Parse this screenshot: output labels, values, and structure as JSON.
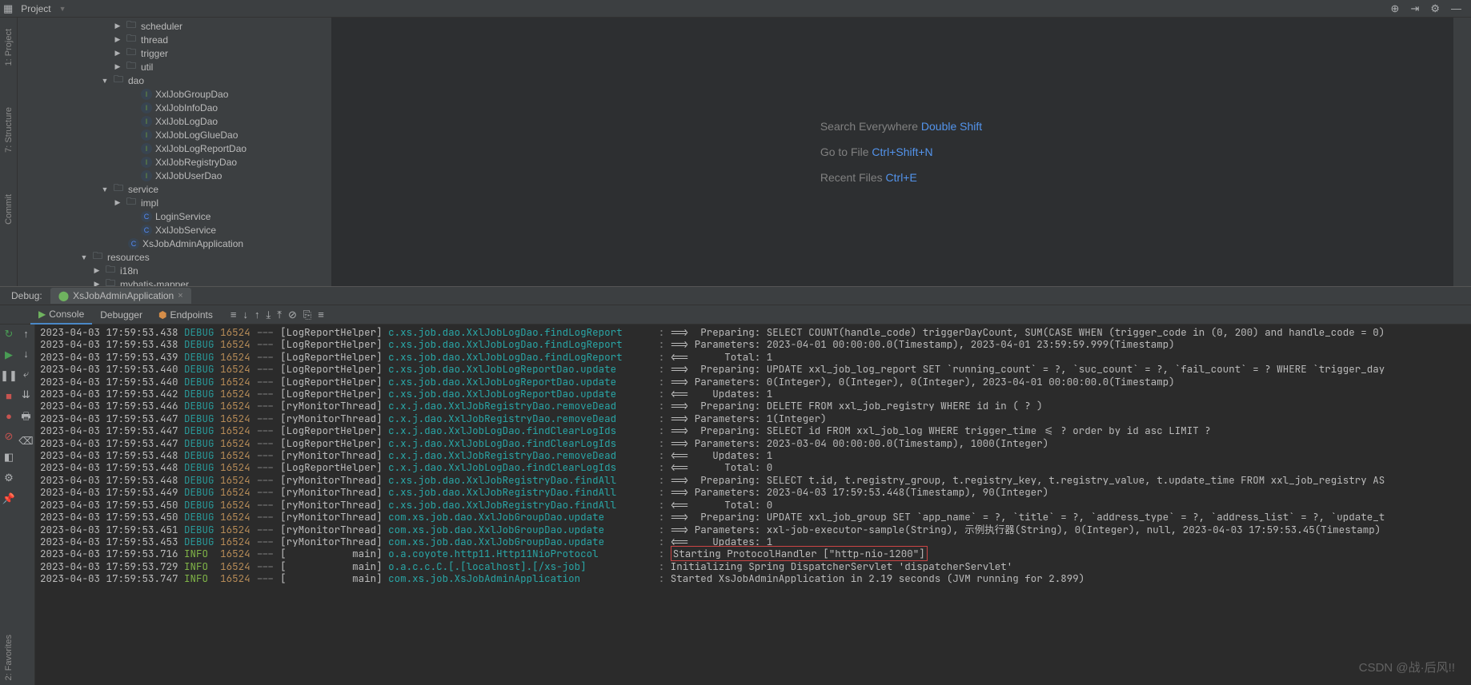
{
  "topbar": {
    "title": "Project"
  },
  "sidebar": {
    "vtabs": [
      "1: Project",
      "7: Structure",
      "Commit"
    ],
    "vtabs_right": [
      "2: Favorites"
    ]
  },
  "tree": [
    {
      "indent": 120,
      "arrow": "▶",
      "icon": "folder",
      "label": "scheduler"
    },
    {
      "indent": 120,
      "arrow": "▶",
      "icon": "folder",
      "label": "thread"
    },
    {
      "indent": 120,
      "arrow": "▶",
      "icon": "folder",
      "label": "trigger"
    },
    {
      "indent": 120,
      "arrow": "▶",
      "icon": "folder",
      "label": "util"
    },
    {
      "indent": 104,
      "arrow": "▼",
      "icon": "folder",
      "label": "dao"
    },
    {
      "indent": 140,
      "arrow": "",
      "icon": "interface",
      "label": "XxlJobGroupDao"
    },
    {
      "indent": 140,
      "arrow": "",
      "icon": "interface",
      "label": "XxlJobInfoDao"
    },
    {
      "indent": 140,
      "arrow": "",
      "icon": "interface",
      "label": "XxlJobLogDao"
    },
    {
      "indent": 140,
      "arrow": "",
      "icon": "interface",
      "label": "XxlJobLogGlueDao"
    },
    {
      "indent": 140,
      "arrow": "",
      "icon": "interface",
      "label": "XxlJobLogReportDao"
    },
    {
      "indent": 140,
      "arrow": "",
      "icon": "interface",
      "label": "XxlJobRegistryDao"
    },
    {
      "indent": 140,
      "arrow": "",
      "icon": "interface",
      "label": "XxlJobUserDao"
    },
    {
      "indent": 104,
      "arrow": "▼",
      "icon": "folder",
      "label": "service"
    },
    {
      "indent": 120,
      "arrow": "▶",
      "icon": "folder",
      "label": "impl"
    },
    {
      "indent": 140,
      "arrow": "",
      "icon": "class",
      "label": "LoginService"
    },
    {
      "indent": 140,
      "arrow": "",
      "icon": "class",
      "label": "XxlJobService"
    },
    {
      "indent": 124,
      "arrow": "",
      "icon": "class",
      "label": "XsJobAdminApplication"
    },
    {
      "indent": 78,
      "arrow": "▼",
      "icon": "folder",
      "label": "resources"
    },
    {
      "indent": 94,
      "arrow": "▶",
      "icon": "folder",
      "label": "i18n"
    },
    {
      "indent": 94,
      "arrow": "▶",
      "icon": "folder",
      "label": "mybatis-mapper"
    }
  ],
  "hints": [
    {
      "label": "Search Everywhere",
      "shortcut": "Double Shift"
    },
    {
      "label": "Go to File",
      "shortcut": "Ctrl+Shift+N"
    },
    {
      "label": "Recent Files",
      "shortcut": "Ctrl+E"
    }
  ],
  "debug": {
    "label": "Debug:",
    "tab": "XsJobAdminApplication",
    "tools": [
      "Console",
      "Debugger",
      "Endpoints"
    ]
  },
  "log": [
    {
      "ts": "2023-04-03 17:59:53.438",
      "lvl": "DEBUG",
      "pid": "16524",
      "thread": "[LogReportHelper]",
      "logger": "c.xs.job.dao.XxlJobLogDao.findLogReport",
      "msg": "==>  Preparing: SELECT COUNT(handle_code) triggerDayCount, SUM(CASE WHEN (trigger_code in (0, 200) and handle_code = 0)"
    },
    {
      "ts": "2023-04-03 17:59:53.438",
      "lvl": "DEBUG",
      "pid": "16524",
      "thread": "[LogReportHelper]",
      "logger": "c.xs.job.dao.XxlJobLogDao.findLogReport",
      "msg": "==> Parameters: 2023-04-01 00:00:00.0(Timestamp), 2023-04-01 23:59:59.999(Timestamp)"
    },
    {
      "ts": "2023-04-03 17:59:53.439",
      "lvl": "DEBUG",
      "pid": "16524",
      "thread": "[LogReportHelper]",
      "logger": "c.xs.job.dao.XxlJobLogDao.findLogReport",
      "msg": "<==      Total: 1"
    },
    {
      "ts": "2023-04-03 17:59:53.440",
      "lvl": "DEBUG",
      "pid": "16524",
      "thread": "[LogReportHelper]",
      "logger": "c.xs.job.dao.XxlJobLogReportDao.update",
      "msg": "==>  Preparing: UPDATE xxl_job_log_report SET `running_count` = ?, `suc_count` = ?, `fail_count` = ? WHERE `trigger_day"
    },
    {
      "ts": "2023-04-03 17:59:53.440",
      "lvl": "DEBUG",
      "pid": "16524",
      "thread": "[LogReportHelper]",
      "logger": "c.xs.job.dao.XxlJobLogReportDao.update",
      "msg": "==> Parameters: 0(Integer), 0(Integer), 0(Integer), 2023-04-01 00:00:00.0(Timestamp)"
    },
    {
      "ts": "2023-04-03 17:59:53.442",
      "lvl": "DEBUG",
      "pid": "16524",
      "thread": "[LogReportHelper]",
      "logger": "c.xs.job.dao.XxlJobLogReportDao.update",
      "msg": "<==    Updates: 1"
    },
    {
      "ts": "2023-04-03 17:59:53.446",
      "lvl": "DEBUG",
      "pid": "16524",
      "thread": "[ryMonitorThread]",
      "logger": "c.x.j.dao.XxlJobRegistryDao.removeDead",
      "msg": "==>  Preparing: DELETE FROM xxl_job_registry WHERE id in ( ? )"
    },
    {
      "ts": "2023-04-03 17:59:53.447",
      "lvl": "DEBUG",
      "pid": "16524",
      "thread": "[ryMonitorThread]",
      "logger": "c.x.j.dao.XxlJobRegistryDao.removeDead",
      "msg": "==> Parameters: 1(Integer)"
    },
    {
      "ts": "2023-04-03 17:59:53.447",
      "lvl": "DEBUG",
      "pid": "16524",
      "thread": "[LogReportHelper]",
      "logger": "c.x.j.dao.XxlJobLogDao.findClearLogIds",
      "msg": "==>  Preparing: SELECT id FROM xxl_job_log WHERE trigger_time <= ? order by id asc LIMIT ?"
    },
    {
      "ts": "2023-04-03 17:59:53.447",
      "lvl": "DEBUG",
      "pid": "16524",
      "thread": "[LogReportHelper]",
      "logger": "c.x.j.dao.XxlJobLogDao.findClearLogIds",
      "msg": "==> Parameters: 2023-03-04 00:00:00.0(Timestamp), 1000(Integer)"
    },
    {
      "ts": "2023-04-03 17:59:53.448",
      "lvl": "DEBUG",
      "pid": "16524",
      "thread": "[ryMonitorThread]",
      "logger": "c.x.j.dao.XxlJobRegistryDao.removeDead",
      "msg": "<==    Updates: 1"
    },
    {
      "ts": "2023-04-03 17:59:53.448",
      "lvl": "DEBUG",
      "pid": "16524",
      "thread": "[LogReportHelper]",
      "logger": "c.x.j.dao.XxlJobLogDao.findClearLogIds",
      "msg": "<==      Total: 0"
    },
    {
      "ts": "2023-04-03 17:59:53.448",
      "lvl": "DEBUG",
      "pid": "16524",
      "thread": "[ryMonitorThread]",
      "logger": "c.xs.job.dao.XxlJobRegistryDao.findAll",
      "msg": "==>  Preparing: SELECT t.id, t.registry_group, t.registry_key, t.registry_value, t.update_time FROM xxl_job_registry AS"
    },
    {
      "ts": "2023-04-03 17:59:53.449",
      "lvl": "DEBUG",
      "pid": "16524",
      "thread": "[ryMonitorThread]",
      "logger": "c.xs.job.dao.XxlJobRegistryDao.findAll",
      "msg": "==> Parameters: 2023-04-03 17:59:53.448(Timestamp), 90(Integer)"
    },
    {
      "ts": "2023-04-03 17:59:53.450",
      "lvl": "DEBUG",
      "pid": "16524",
      "thread": "[ryMonitorThread]",
      "logger": "c.xs.job.dao.XxlJobRegistryDao.findAll",
      "msg": "<==      Total: 0"
    },
    {
      "ts": "2023-04-03 17:59:53.450",
      "lvl": "DEBUG",
      "pid": "16524",
      "thread": "[ryMonitorThread]",
      "logger": "com.xs.job.dao.XxlJobGroupDao.update",
      "msg": "==>  Preparing: UPDATE xxl_job_group SET `app_name` = ?, `title` = ?, `address_type` = ?, `address_list` = ?, `update_t"
    },
    {
      "ts": "2023-04-03 17:59:53.451",
      "lvl": "DEBUG",
      "pid": "16524",
      "thread": "[ryMonitorThread]",
      "logger": "com.xs.job.dao.XxlJobGroupDao.update",
      "msg": "==> Parameters: xxl-job-executor-sample(String), 示例执行器(String), 0(Integer), null, 2023-04-03 17:59:53.45(Timestamp)"
    },
    {
      "ts": "2023-04-03 17:59:53.453",
      "lvl": "DEBUG",
      "pid": "16524",
      "thread": "[ryMonitorThread]",
      "logger": "com.xs.job.dao.XxlJobGroupDao.update",
      "msg": "<==    Updates: 1"
    },
    {
      "ts": "2023-04-03 17:59:53.716",
      "lvl": "INFO",
      "pid": "16524",
      "thread": "[           main]",
      "logger": "o.a.coyote.http11.Http11NioProtocol",
      "msg": "Starting ProtocolHandler [\"http-nio-1200\"]",
      "hl": true
    },
    {
      "ts": "2023-04-03 17:59:53.729",
      "lvl": "INFO",
      "pid": "16524",
      "thread": "[           main]",
      "logger": "o.a.c.c.C.[.[localhost].[/xs-job]",
      "msg": "Initializing Spring DispatcherServlet 'dispatcherServlet'"
    },
    {
      "ts": "2023-04-03 17:59:53.747",
      "lvl": "INFO",
      "pid": "16524",
      "thread": "[           main]",
      "logger": "com.xs.job.XsJobAdminApplication",
      "msg": "Started XsJobAdminApplication in 2.19 seconds (JVM running for 2.899)"
    }
  ],
  "watermark": "CSDN @战·后风!!"
}
